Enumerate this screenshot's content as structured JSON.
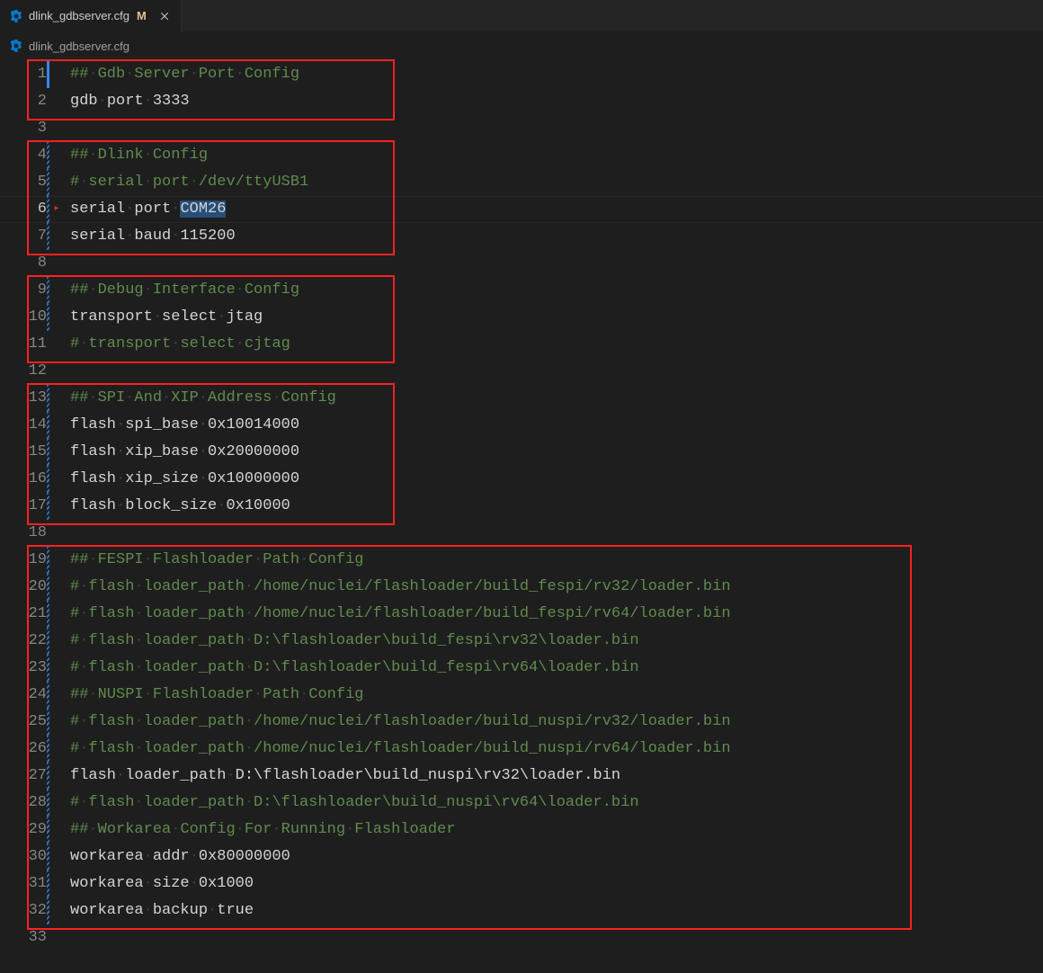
{
  "tab": {
    "filename": "dlink_gdbserver.cfg",
    "modified_marker": "M"
  },
  "breadcrumb": {
    "filename": "dlink_gdbserver.cfg"
  },
  "current_line": 6,
  "selection": {
    "line": 6,
    "text": "COM26"
  },
  "lines": [
    {
      "n": 1,
      "segments": [
        {
          "t": "## Gdb Server Port Config",
          "c": "comment",
          "dots": [
            2,
            6,
            13,
            18
          ]
        }
      ]
    },
    {
      "n": 2,
      "segments": [
        {
          "t": "gdb port 3333",
          "c": "normal",
          "dots": [
            3,
            8
          ]
        }
      ]
    },
    {
      "n": 3,
      "segments": []
    },
    {
      "n": 4,
      "segments": [
        {
          "t": "## Dlink Config",
          "c": "comment",
          "dots": [
            2,
            8
          ]
        }
      ]
    },
    {
      "n": 5,
      "segments": [
        {
          "t": "# serial port /dev/ttyUSB1",
          "c": "comment",
          "dots": [
            1,
            8,
            13
          ]
        }
      ]
    },
    {
      "n": 6,
      "segments": [
        {
          "t": "serial port ",
          "c": "normal",
          "dots": [
            6,
            11
          ]
        },
        {
          "t": "COM26",
          "c": "normal",
          "sel": true
        }
      ]
    },
    {
      "n": 7,
      "segments": [
        {
          "t": "serial baud 115200",
          "c": "normal",
          "dots": [
            6,
            11
          ]
        }
      ]
    },
    {
      "n": 8,
      "segments": []
    },
    {
      "n": 9,
      "segments": [
        {
          "t": "## Debug Interface Config",
          "c": "comment",
          "dots": [
            2,
            8,
            18
          ]
        }
      ]
    },
    {
      "n": 10,
      "segments": [
        {
          "t": "transport select jtag",
          "c": "normal",
          "dots": [
            9,
            16
          ]
        }
      ]
    },
    {
      "n": 11,
      "segments": [
        {
          "t": "# transport select cjtag",
          "c": "comment",
          "dots": [
            1,
            11,
            18
          ]
        }
      ]
    },
    {
      "n": 12,
      "segments": []
    },
    {
      "n": 13,
      "segments": [
        {
          "t": "## SPI And XIP Address Config",
          "c": "comment",
          "dots": [
            2,
            6,
            10,
            14,
            22
          ]
        }
      ]
    },
    {
      "n": 14,
      "segments": [
        {
          "t": "flash spi_base 0x10014000",
          "c": "normal",
          "dots": [
            5,
            14
          ]
        }
      ]
    },
    {
      "n": 15,
      "segments": [
        {
          "t": "flash xip_base 0x20000000",
          "c": "normal",
          "dots": [
            5,
            14
          ]
        }
      ]
    },
    {
      "n": 16,
      "segments": [
        {
          "t": "flash xip_size 0x10000000",
          "c": "normal",
          "dots": [
            5,
            14
          ]
        }
      ]
    },
    {
      "n": 17,
      "segments": [
        {
          "t": "flash block_size 0x10000",
          "c": "normal",
          "dots": [
            5,
            16
          ]
        }
      ]
    },
    {
      "n": 18,
      "segments": []
    },
    {
      "n": 19,
      "segments": [
        {
          "t": "## FESPI Flashloader Path Config",
          "c": "comment",
          "dots": [
            2,
            8,
            20,
            25
          ]
        }
      ]
    },
    {
      "n": 20,
      "segments": [
        {
          "t": "# flash loader_path /home/nuclei/flashloader/build_fespi/rv32/loader.bin",
          "c": "comment",
          "dots": [
            1,
            7,
            19
          ]
        }
      ]
    },
    {
      "n": 21,
      "segments": [
        {
          "t": "# flash loader_path /home/nuclei/flashloader/build_fespi/rv64/loader.bin",
          "c": "comment",
          "dots": [
            1,
            7,
            19
          ]
        }
      ]
    },
    {
      "n": 22,
      "segments": [
        {
          "t": "# flash loader_path D:\\flashloader\\build_fespi\\rv32\\loader.bin",
          "c": "comment",
          "dots": [
            1,
            7,
            19
          ]
        }
      ]
    },
    {
      "n": 23,
      "segments": [
        {
          "t": "# flash loader_path D:\\flashloader\\build_fespi\\rv64\\loader.bin",
          "c": "comment",
          "dots": [
            1,
            7,
            19
          ]
        }
      ]
    },
    {
      "n": 24,
      "segments": [
        {
          "t": "## NUSPI Flashloader Path Config",
          "c": "comment",
          "dots": [
            2,
            8,
            20,
            25
          ]
        }
      ]
    },
    {
      "n": 25,
      "segments": [
        {
          "t": "# flash loader_path /home/nuclei/flashloader/build_nuspi/rv32/loader.bin",
          "c": "comment",
          "dots": [
            1,
            7,
            19
          ]
        }
      ]
    },
    {
      "n": 26,
      "segments": [
        {
          "t": "# flash loader_path /home/nuclei/flashloader/build_nuspi/rv64/loader.bin",
          "c": "comment",
          "dots": [
            1,
            7,
            19
          ]
        }
      ]
    },
    {
      "n": 27,
      "segments": [
        {
          "t": "flash loader_path D:\\flashloader\\build_nuspi\\rv32\\loader.bin",
          "c": "normal",
          "dots": [
            5,
            17
          ]
        }
      ]
    },
    {
      "n": 28,
      "segments": [
        {
          "t": "# flash loader_path D:\\flashloader\\build_nuspi\\rv64\\loader.bin",
          "c": "comment",
          "dots": [
            1,
            7,
            19
          ]
        }
      ]
    },
    {
      "n": 29,
      "segments": [
        {
          "t": "## Workarea Config For Running Flashloader",
          "c": "comment",
          "dots": [
            2,
            11,
            18,
            22,
            30
          ]
        }
      ]
    },
    {
      "n": 30,
      "segments": [
        {
          "t": "workarea addr 0x80000000",
          "c": "normal",
          "dots": [
            8,
            13
          ]
        }
      ]
    },
    {
      "n": 31,
      "segments": [
        {
          "t": "workarea size 0x1000",
          "c": "normal",
          "dots": [
            8,
            13
          ]
        }
      ]
    },
    {
      "n": 32,
      "segments": [
        {
          "t": "workarea backup true",
          "c": "normal",
          "dots": [
            8,
            15
          ]
        }
      ]
    },
    {
      "n": 33,
      "segments": []
    }
  ],
  "diff_bars": [
    {
      "line": 1,
      "kind": "solid"
    },
    {
      "line": 4,
      "kind": "hash"
    },
    {
      "line": 5,
      "kind": "hash"
    },
    {
      "line": 6,
      "kind": "hash"
    },
    {
      "line": 7,
      "kind": "hash"
    },
    {
      "line": 9,
      "kind": "hash"
    },
    {
      "line": 10,
      "kind": "hash"
    },
    {
      "line": 13,
      "kind": "hash"
    },
    {
      "line": 14,
      "kind": "hash"
    },
    {
      "line": 15,
      "kind": "hash"
    },
    {
      "line": 16,
      "kind": "hash"
    },
    {
      "line": 17,
      "kind": "hash"
    },
    {
      "line": 19,
      "kind": "hash"
    },
    {
      "line": 20,
      "kind": "hash"
    },
    {
      "line": 21,
      "kind": "hash"
    },
    {
      "line": 22,
      "kind": "hash"
    },
    {
      "line": 23,
      "kind": "hash"
    },
    {
      "line": 24,
      "kind": "hash"
    },
    {
      "line": 25,
      "kind": "hash"
    },
    {
      "line": 26,
      "kind": "hash"
    },
    {
      "line": 27,
      "kind": "hash"
    },
    {
      "line": 28,
      "kind": "hash"
    },
    {
      "line": 29,
      "kind": "hash"
    },
    {
      "line": 30,
      "kind": "hash"
    },
    {
      "line": 31,
      "kind": "hash"
    },
    {
      "line": 32,
      "kind": "hash"
    }
  ],
  "boxes": [
    {
      "start": 1,
      "end": 2
    },
    {
      "start": 4,
      "end": 7
    },
    {
      "start": 9,
      "end": 11
    },
    {
      "start": 13,
      "end": 17
    },
    {
      "start": 19,
      "end": 32,
      "wide": true
    }
  ]
}
